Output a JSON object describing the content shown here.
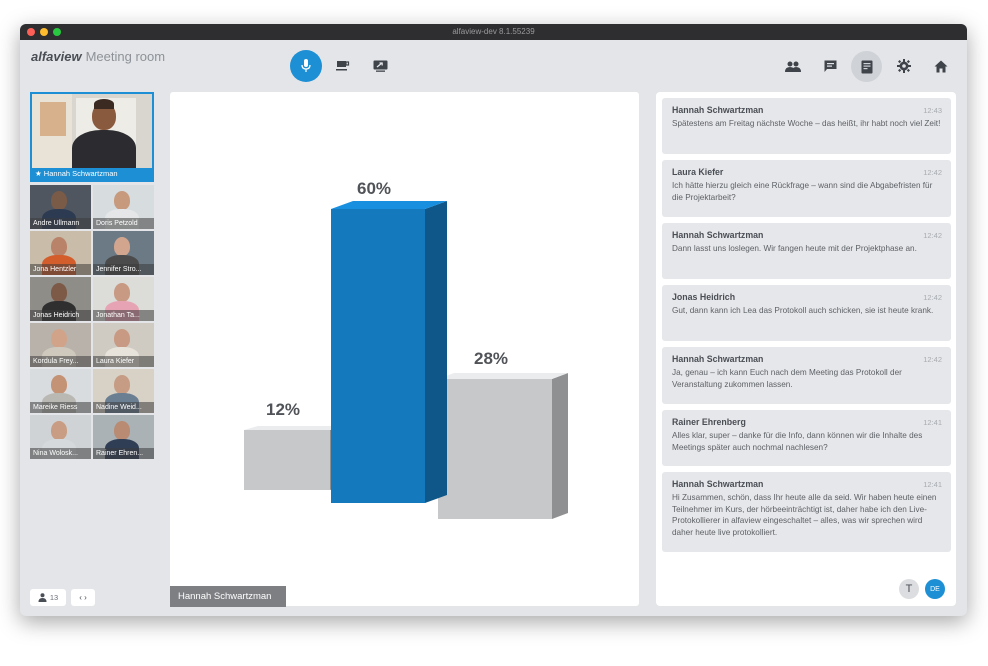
{
  "window": {
    "title": "alfaview-dev 8.1.55239"
  },
  "brand": {
    "logo": "alfaview",
    "room": "Meeting room"
  },
  "toolbar": {
    "left": [
      {
        "name": "microphone",
        "icon": "microphone-icon",
        "active": true
      },
      {
        "name": "coffee-break",
        "icon": "coffee-cup-icon"
      },
      {
        "name": "screen-share",
        "icon": "screen-share-icon"
      }
    ],
    "right": [
      {
        "name": "participants",
        "icon": "people-icon"
      },
      {
        "name": "chat",
        "icon": "chat-icon"
      },
      {
        "name": "transcript",
        "icon": "document-transcript-icon",
        "active": true
      },
      {
        "name": "settings",
        "icon": "gear-icon"
      },
      {
        "name": "home",
        "icon": "home-icon"
      }
    ]
  },
  "participants": {
    "main": {
      "name": "★ Hannah Schwartzman"
    },
    "tiles": [
      {
        "name": "Andre Ullmann"
      },
      {
        "name": "Doris Petzold"
      },
      {
        "name": "Jona Hentzler"
      },
      {
        "name": "Jennifer Stro..."
      },
      {
        "name": "Jonas Heidrich"
      },
      {
        "name": "Jonathan Ta..."
      },
      {
        "name": "Kordula Frey..."
      },
      {
        "name": "Laura Kiefer"
      },
      {
        "name": "Mareike Riess"
      },
      {
        "name": "Nadine Weid..."
      },
      {
        "name": "Nina Wolosk..."
      },
      {
        "name": "Rainer Ehren..."
      }
    ],
    "count": "13"
  },
  "stage": {
    "speaker_label": "Hannah Schwartzman"
  },
  "chart_data": {
    "type": "bar",
    "categories": [
      "",
      "",
      ""
    ],
    "values": [
      12,
      60,
      28
    ],
    "labels": [
      "12%",
      "60%",
      "28%"
    ],
    "colors": [
      "#c7c8ca",
      "#1479bd",
      "#c7c8ca"
    ]
  },
  "chat": {
    "messages": [
      {
        "author": "Hannah Schwartzman",
        "time": "12:43",
        "text": "Spätestens am Freitag nächste Woche – das heißt, ihr habt noch viel Zeit!"
      },
      {
        "author": "Laura Kiefer",
        "time": "12:42",
        "text": "Ich hätte hierzu gleich eine Rückfrage – wann sind die Abgabefristen für die Projektarbeit?"
      },
      {
        "author": "Hannah Schwartzman",
        "time": "12:42",
        "text": "Dann lasst uns loslegen. Wir fangen heute mit der Projektphase an."
      },
      {
        "author": "Jonas Heidrich",
        "time": "12:42",
        "text": "Gut, dann kann ich Lea das Protokoll auch schicken, sie ist heute krank."
      },
      {
        "author": "Hannah Schwartzman",
        "time": "12:42",
        "text": "Ja, genau – ich kann Euch nach dem Meeting das Protokoll der Veranstaltung zukommen lassen."
      },
      {
        "author": "Rainer Ehrenberg",
        "time": "12:41",
        "text": "Alles klar, super – danke für die Info, dann können wir die Inhalte des Meetings später auch nochmal nachlesen?"
      },
      {
        "author": "Hannah Schwartzman",
        "time": "12:41",
        "text": "Hi Zusammen, schön, dass Ihr heute alle da seid. Wir haben heute einen Teilnehmer im Kurs, der hörbeeinträchtigt ist, daher habe ich den Live-Protokollierer in alfaview eingeschaltet – alles, was wir sprechen wird daher heute live protokolliert."
      }
    ],
    "font_button": "T",
    "language_button": "DE"
  },
  "colors": {
    "accent": "#1d8fd4",
    "background": "#e3e5e8"
  }
}
